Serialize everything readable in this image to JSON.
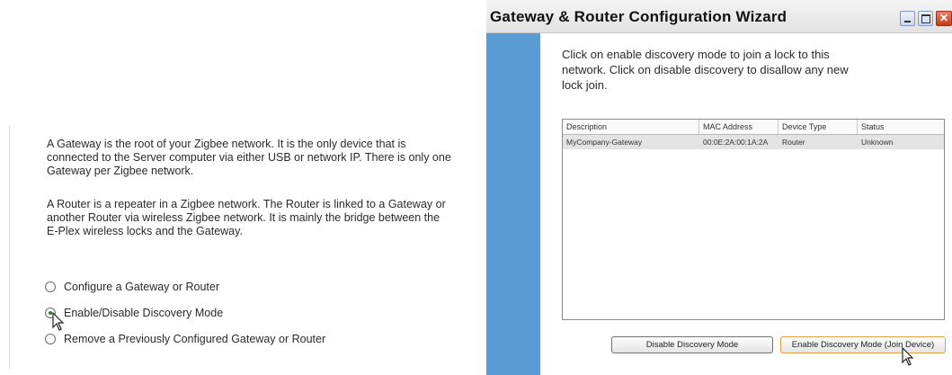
{
  "left_pane": {
    "paragraph1": "A Gateway is the root of your Zigbee network. It is the only device that is connected to the Server computer via either USB or network IP. There is only one Gateway per Zigbee network.",
    "paragraph2": "A Router is a repeater in a Zigbee network. The Router is linked to a Gateway or another Router via wireless Zigbee network. It is mainly the bridge between the E-Plex wireless locks and the Gateway.",
    "options": [
      {
        "label": "Configure a Gateway or Router",
        "checked": false
      },
      {
        "label": "Enable/Disable Discovery Mode",
        "checked": true
      },
      {
        "label": "Remove a Previously Configured Gateway or Router",
        "checked": false
      }
    ]
  },
  "wizard": {
    "title": "Gateway & Router Configuration Wizard",
    "instructions": "Click on enable discovery mode to join a lock to this network. Click on disable discovery to disallow any new lock join.",
    "table": {
      "columns": [
        "Description",
        "MAC Address",
        "Device Type",
        "Status"
      ],
      "rows": [
        [
          "MyCompany-Gateway",
          "00:0E:2A:00:1A:2A",
          "Router",
          "Unknown"
        ]
      ]
    },
    "buttons": {
      "disable": "Disable Discovery Mode",
      "enable": "Enable Discovery Mode (Join Device)"
    }
  },
  "colors": {
    "side_panel": "#5b9bd5",
    "selected_row": "#e3e3e3",
    "close_button": "#c23b1c"
  }
}
